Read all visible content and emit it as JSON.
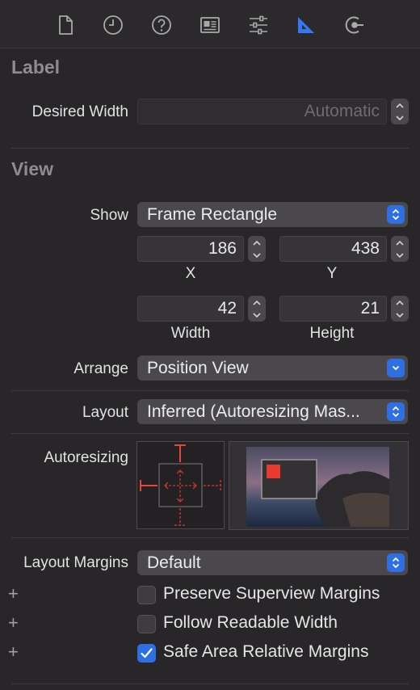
{
  "toolbar": {
    "tabs": [
      {
        "name": "file-inspector",
        "icon": "file-icon"
      },
      {
        "name": "history-inspector",
        "icon": "clock-icon"
      },
      {
        "name": "quick-help",
        "icon": "question-icon"
      },
      {
        "name": "identity-inspector",
        "icon": "id-card-icon"
      },
      {
        "name": "attributes-inspector",
        "icon": "sliders-icon"
      },
      {
        "name": "size-inspector",
        "icon": "ruler-triangle-icon",
        "selected": true
      },
      {
        "name": "connections-inspector",
        "icon": "connection-icon"
      }
    ],
    "accent": "#3478f6"
  },
  "label_section": {
    "title": "Label",
    "desired_width_label": "Desired Width",
    "desired_width_placeholder": "Automatic"
  },
  "view_section": {
    "title": "View",
    "show_label": "Show",
    "show_value": "Frame Rectangle",
    "x_value": "186",
    "x_label": "X",
    "y_value": "438",
    "y_label": "Y",
    "width_value": "42",
    "width_label": "Width",
    "height_value": "21",
    "height_label": "Height",
    "arrange_label": "Arrange",
    "arrange_value": "Position View",
    "layout_label": "Layout",
    "layout_value": "Inferred (Autoresizing Mas...",
    "autoresizing_label": "Autoresizing"
  },
  "margins": {
    "label": "Layout Margins",
    "value": "Default",
    "plus": "+",
    "options": [
      {
        "label": "Preserve Superview Margins",
        "checked": false
      },
      {
        "label": "Follow Readable Width",
        "checked": false
      },
      {
        "label": "Safe Area Relative Margins",
        "checked": true
      }
    ]
  }
}
